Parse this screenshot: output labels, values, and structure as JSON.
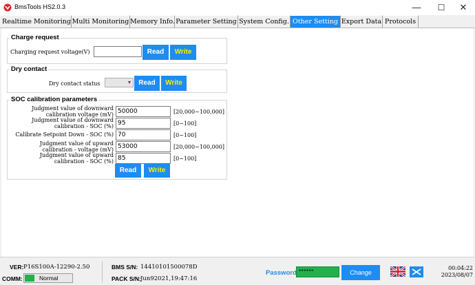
{
  "window": {
    "title": "BmsTools HS2.0.3",
    "controls": {
      "minimize": "—",
      "maximize": "☐",
      "close": "✕"
    }
  },
  "tabs": [
    {
      "label": "Realtime Monitoring",
      "active": false
    },
    {
      "label": "Multi Monitoring",
      "active": false
    },
    {
      "label": "Memory Info.",
      "active": false
    },
    {
      "label": "Parameter Setting",
      "active": false
    },
    {
      "label": "System Config.",
      "active": false
    },
    {
      "label": "Other Setting",
      "active": true
    },
    {
      "label": "Export Data",
      "active": false
    },
    {
      "label": "Protocols",
      "active": false
    }
  ],
  "charge_request": {
    "title": "Charge request",
    "voltage_label": "Charging request voltage(V)",
    "voltage_value": "",
    "read_label": "Read",
    "write_label": "Write"
  },
  "dry_contact": {
    "title": "Dry contact",
    "status_label": "Dry contact status",
    "status_value": "",
    "read_label": "Read",
    "write_label": "Write"
  },
  "soc_calibration": {
    "title": "SOC calibration parameters",
    "rows": [
      {
        "label_line1": "Judgment value of downward",
        "label_line2": "calibration voltage (mV)",
        "value": "50000",
        "range": "[20,000~100,000]"
      },
      {
        "label_line1": "Judgment value of downward",
        "label_line2": "calibration - SOC (%)",
        "value": "95",
        "range": "[0~100]"
      },
      {
        "label_line1": "Calibrate Setpoint Down - SOC (%)",
        "label_line2": "",
        "value": "70",
        "range": "[0~100]"
      },
      {
        "label_line1": "Judgment value of upward",
        "label_line2": "calibration - voltage (mV)",
        "value": "53000",
        "range": "[20,000~100,000]"
      },
      {
        "label_line1": "Judgment value of upward",
        "label_line2": "calibration - SOC (%)",
        "value": "85",
        "range": "[0~100]"
      }
    ],
    "read_label": "Read",
    "write_label": "Write"
  },
  "status_bar": {
    "ver_key": "VER:",
    "ver_value": "P16S100A-12290-2.50",
    "comm_key": "COMM:",
    "comm_value": "Normal",
    "bms_sn_key": "BMS S/N:",
    "bms_sn_value": "14410101500078D",
    "pack_sn_key": "PACK S/N:",
    "pack_sn_value": "Jun92021,19:47:16",
    "password_label": "Password",
    "password_value": "******",
    "change_label": "Change",
    "time": "00:04:22",
    "date": "2023/08/07"
  },
  "colors": {
    "accent": "#1e8cf0",
    "write_text": "#ffee00",
    "status_ok": "#22b14c"
  },
  "icons": {
    "app": "bms-logo-icon",
    "language": "uk-flag-icon",
    "device": "device-link-icon"
  }
}
